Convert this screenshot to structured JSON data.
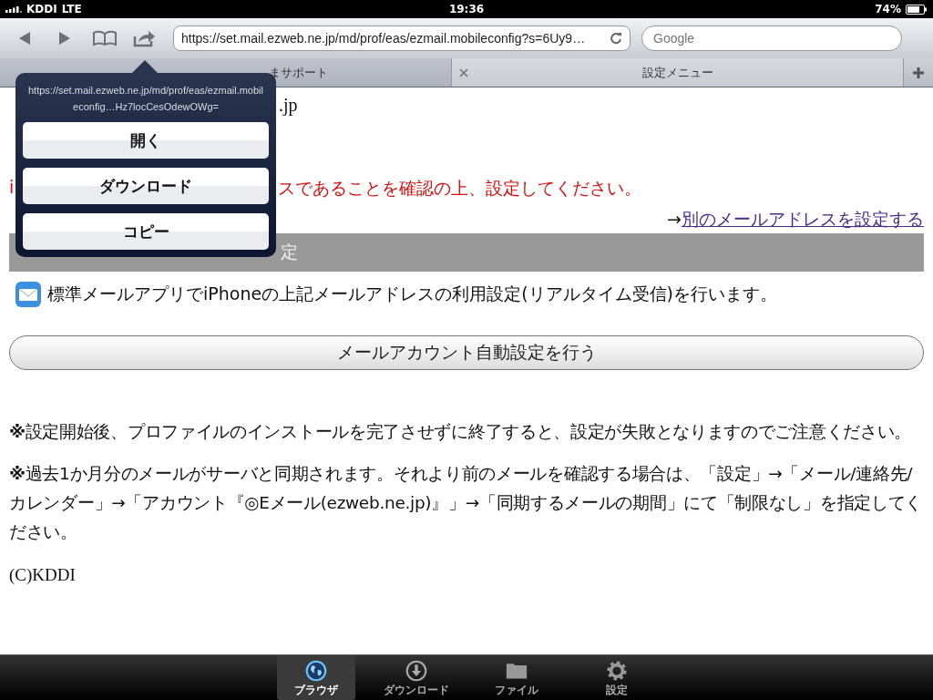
{
  "status_bar": {
    "carrier": "KDDI",
    "network": "LTE",
    "time": "19:36",
    "battery": "74%"
  },
  "toolbar": {
    "url": "https://set.mail.ezweb.ne.jp/md/prof/eas/ezmail.mobileconfig?s=6Uy9…",
    "search": {
      "placeholder": "Google"
    }
  },
  "tabs": [
    {
      "label": "まサポート",
      "selected": false
    },
    {
      "label": "設定メニュー",
      "selected": true
    }
  ],
  "page": {
    "email_fragment": ".jp",
    "warning_start": "i",
    "warning_rest": "スであることを確認の上、設定してください。",
    "arrow": "→",
    "link": "別のメールアドレスを設定する",
    "section_fragment": "定",
    "description": "標準メールアプリでiPhoneの上記メールアドレスの利用設定(リアルタイム受信)を行います。",
    "button": "メールアカウント自動設定を行う",
    "notes": [
      {
        "mark": "※",
        "text": "設定開始後、プロファイルのインストールを完了させずに終了すると、設定が失敗となりますのでご注意ください。"
      },
      {
        "mark": "※",
        "text": "過去1か月分のメールがサーバと同期されます。それより前のメールを確認する場合は、「設定」→「メール/連絡先/カレンダー」→「アカウント『◎Eメール(ezweb.ne.jp)』」→「同期するメールの期間」にて「制限なし」を指定してください。"
      }
    ],
    "copyright": "(C)KDDI"
  },
  "popover": {
    "url": "https://set.mail.ezweb.ne.jp/md/prof/eas/ezmail.mobileconfig…Hz7locCesOdewOWg=",
    "actions": [
      "開く",
      "ダウンロード",
      "コピー"
    ]
  },
  "bottom_tabs": [
    {
      "label": "ブラウザ",
      "kind": "globe",
      "selected": true
    },
    {
      "label": "ダウンロード",
      "kind": "download",
      "selected": false
    },
    {
      "label": "ファイル",
      "kind": "folder",
      "selected": false
    },
    {
      "label": "設定",
      "kind": "gear",
      "selected": false
    }
  ]
}
